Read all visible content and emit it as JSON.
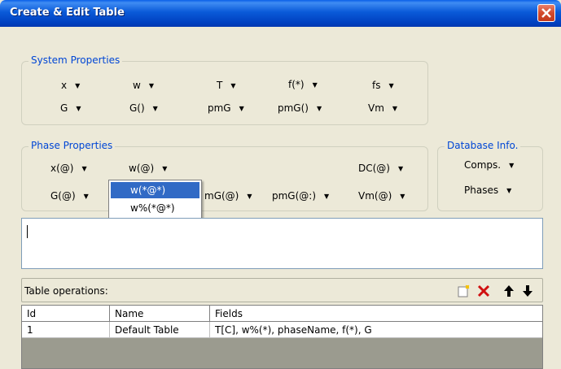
{
  "window": {
    "title": "Create & Edit Table"
  },
  "system_properties": {
    "legend": "System Properties",
    "row1": [
      "x",
      "w",
      "T",
      "f(*)",
      "fs"
    ],
    "row2": [
      "G",
      "G()",
      "pmG",
      "pmG()",
      "Vm"
    ]
  },
  "phase_properties": {
    "legend": "Phase Properties",
    "row1": [
      "x(@)",
      "w(@)",
      "DC(@)"
    ],
    "row2": [
      "G(@)",
      "mG(@)",
      "pmG(@:)",
      "Vm(@)"
    ]
  },
  "database_info": {
    "legend": "Database Info.",
    "items": [
      "Comps.",
      "Phases"
    ]
  },
  "dropdown": {
    "items": [
      "w(*@*)",
      "w%(*@*)"
    ],
    "selected_index": 0
  },
  "editor": {
    "value": ""
  },
  "table_operations": {
    "label": "Table operations:",
    "icons": [
      "new-table-icon",
      "delete-icon",
      "move-up-icon",
      "move-down-icon"
    ]
  },
  "table": {
    "columns": [
      "Id",
      "Name",
      "Fields"
    ],
    "rows": [
      [
        "1",
        "Default Table",
        "T[C], w%(*), phaseName, f(*), G"
      ]
    ]
  },
  "colors": {
    "title_bar": "#0a5ad8",
    "legend_text": "#0046d5",
    "menu_highlight": "#316ac5",
    "close_button": "#d24a2c"
  }
}
